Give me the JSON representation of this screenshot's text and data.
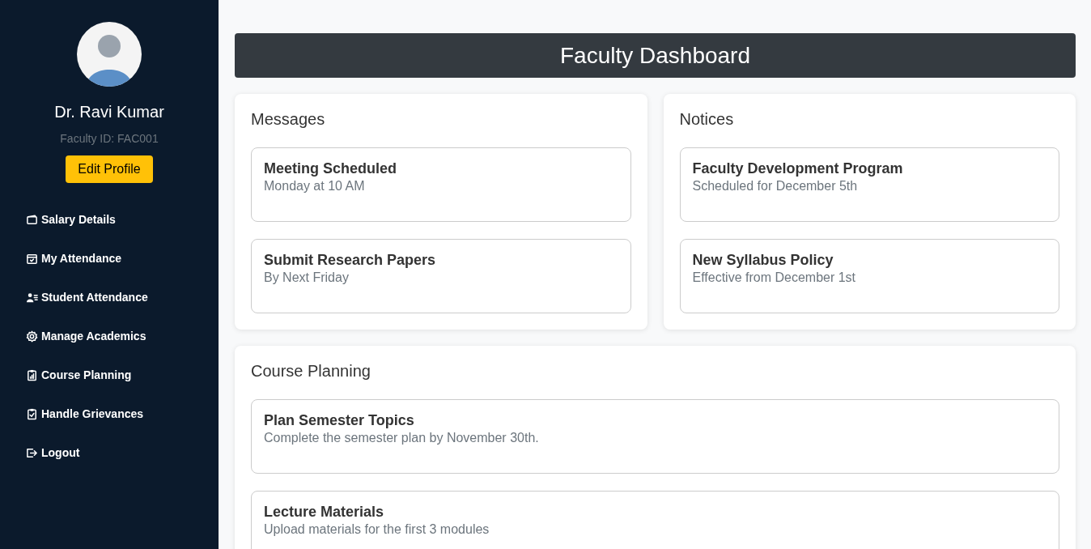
{
  "profile": {
    "name": "Dr. Ravi Kumar",
    "faculty_id": "Faculty ID: FAC001",
    "edit_button": "Edit Profile"
  },
  "nav": [
    {
      "label": "Salary Details"
    },
    {
      "label": "My Attendance"
    },
    {
      "label": "Student Attendance"
    },
    {
      "label": "Manage Academics"
    },
    {
      "label": "Course Planning"
    },
    {
      "label": "Handle Grievances"
    },
    {
      "label": "Logout"
    }
  ],
  "header": {
    "title": "Faculty Dashboard"
  },
  "panels": [
    {
      "title": "Messages",
      "items": [
        {
          "title": "Meeting Scheduled",
          "detail": "Monday at 10 AM"
        },
        {
          "title": "Submit Research Papers",
          "detail": "By Next Friday"
        }
      ]
    },
    {
      "title": "Notices",
      "items": [
        {
          "title": "Faculty Development Program",
          "detail": "Scheduled for December 5th"
        },
        {
          "title": "New Syllabus Policy",
          "detail": "Effective from December 1st"
        }
      ]
    }
  ],
  "course_planning": {
    "title": "Course Planning",
    "items": [
      {
        "title": "Plan Semester Topics",
        "detail": "Complete the semester plan by November 30th."
      },
      {
        "title": "Lecture Materials",
        "detail": "Upload materials for the first 3 modules"
      }
    ]
  }
}
